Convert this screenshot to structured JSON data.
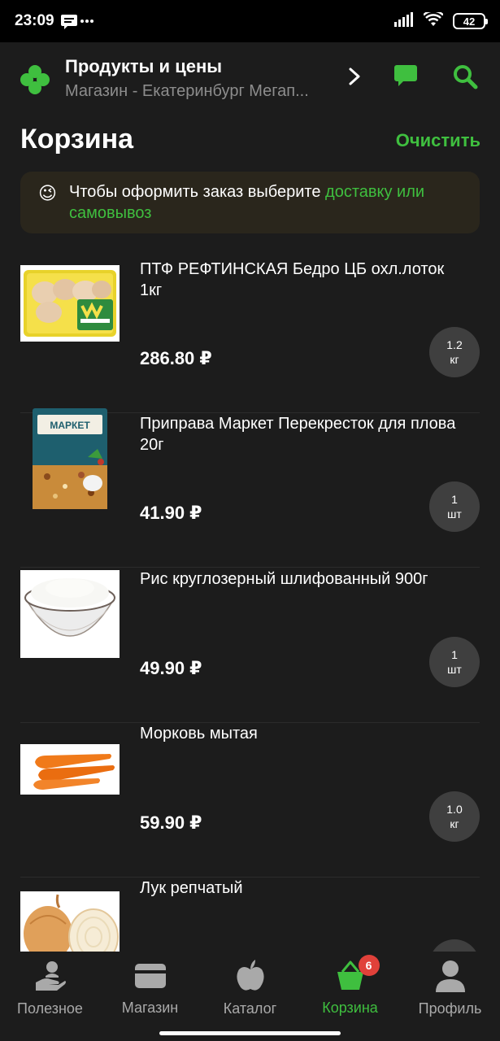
{
  "status": {
    "time": "23:09",
    "battery": "42"
  },
  "header": {
    "title": "Продукты и цены",
    "subtitle": "Магазин - Екатеринбург Мегап..."
  },
  "cart": {
    "title": "Корзина",
    "clear_label": "Очистить",
    "notice": {
      "emoji": "😉",
      "text": "Чтобы оформить заказ выберите ",
      "link": "доставку или самовывоз"
    },
    "items": [
      {
        "name": "ПТФ РЕФТИНСКАЯ Бедро ЦБ охл.лоток 1кг",
        "price": "286.80 ₽",
        "qty": "1.2",
        "unit": "кг"
      },
      {
        "name": "Приправа Маркет Перекресток для плова 20г",
        "price": "41.90 ₽",
        "qty": "1",
        "unit": "шт"
      },
      {
        "name": "Рис круглозерный шлифованный 900г",
        "price": "49.90 ₽",
        "qty": "1",
        "unit": "шт"
      },
      {
        "name": "Морковь мытая",
        "price": "59.90 ₽",
        "qty": "1.0",
        "unit": "кг"
      },
      {
        "name": "Лук репчатый",
        "price": "",
        "qty": "",
        "unit": ""
      }
    ]
  },
  "nav": {
    "items": [
      {
        "label": "Полезное"
      },
      {
        "label": "Магазин"
      },
      {
        "label": "Каталог"
      },
      {
        "label": "Корзина",
        "badge": "6"
      },
      {
        "label": "Профиль"
      }
    ]
  },
  "colors": {
    "accent": "#3fbf3f",
    "background": "#1c1c1c",
    "badge": "#e0413a"
  }
}
